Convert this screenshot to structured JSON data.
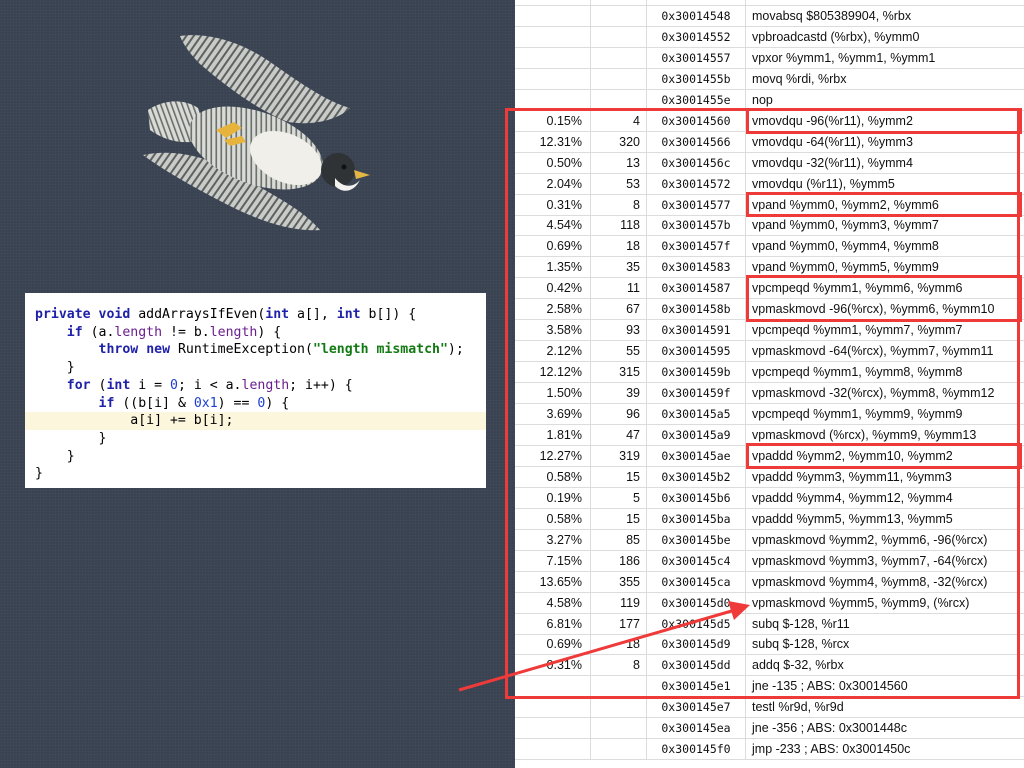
{
  "code": {
    "lines": [
      [
        [
          "kw",
          "private"
        ],
        [
          "",
          " "
        ],
        [
          "kw",
          "void"
        ],
        [
          "",
          " addArraysIfEven("
        ],
        [
          "kw",
          "int"
        ],
        [
          "",
          " a[], "
        ],
        [
          "kw",
          "int"
        ],
        [
          "",
          " b[]) {"
        ]
      ],
      [
        [
          "",
          "    "
        ],
        [
          "kw",
          "if"
        ],
        [
          "",
          " (a."
        ],
        [
          "fld",
          "length"
        ],
        [
          "",
          " != b."
        ],
        [
          "fld",
          "length"
        ],
        [
          "",
          ") {"
        ]
      ],
      [
        [
          "",
          "        "
        ],
        [
          "kw",
          "throw"
        ],
        [
          "",
          " "
        ],
        [
          "kw",
          "new"
        ],
        [
          "",
          " RuntimeException("
        ],
        [
          "str",
          "\"length mismatch\""
        ],
        [
          "",
          ");"
        ]
      ],
      [
        [
          "",
          "    }"
        ]
      ],
      [
        [
          "",
          "    "
        ],
        [
          "kw",
          "for"
        ],
        [
          "",
          " ("
        ],
        [
          "kw",
          "int"
        ],
        [
          "",
          " i = "
        ],
        [
          "num",
          "0"
        ],
        [
          "",
          "; i < a."
        ],
        [
          "fld",
          "length"
        ],
        [
          "",
          "; i++) {"
        ]
      ],
      [
        [
          "",
          "        "
        ],
        [
          "kw",
          "if"
        ],
        [
          "",
          " ((b[i] & "
        ],
        [
          "num",
          "0x1"
        ],
        [
          "",
          ") == "
        ],
        [
          "num",
          "0"
        ],
        [
          "",
          ") {"
        ]
      ],
      [
        [
          "",
          "            a[i] += b[i];"
        ]
      ],
      [
        [
          "",
          "        }"
        ]
      ],
      [
        [
          "",
          "    }"
        ]
      ],
      [
        [
          "",
          "}"
        ]
      ]
    ],
    "highlight_line": 6
  },
  "asm": {
    "rows": [
      [
        "",
        "",
        "",
        ""
      ],
      [
        "",
        "",
        "0x30014548",
        "movabsq $805389904, %rbx"
      ],
      [
        "",
        "",
        "0x30014552",
        "vpbroadcastd (%rbx), %ymm0"
      ],
      [
        "",
        "",
        "0x30014557",
        "vpxor %ymm1, %ymm1, %ymm1"
      ],
      [
        "",
        "",
        "0x3001455b",
        "movq %rdi, %rbx"
      ],
      [
        "",
        "",
        "0x3001455e",
        "nop"
      ],
      [
        "0.15%",
        "4",
        "0x30014560",
        "vmovdqu -96(%r11), %ymm2"
      ],
      [
        "12.31%",
        "320",
        "0x30014566",
        "vmovdqu -64(%r11), %ymm3"
      ],
      [
        "0.50%",
        "13",
        "0x3001456c",
        "vmovdqu -32(%r11), %ymm4"
      ],
      [
        "2.04%",
        "53",
        "0x30014572",
        "vmovdqu (%r11), %ymm5"
      ],
      [
        "0.31%",
        "8",
        "0x30014577",
        "vpand %ymm0, %ymm2, %ymm6"
      ],
      [
        "4.54%",
        "118",
        "0x3001457b",
        "vpand %ymm0, %ymm3, %ymm7"
      ],
      [
        "0.69%",
        "18",
        "0x3001457f",
        "vpand %ymm0, %ymm4, %ymm8"
      ],
      [
        "1.35%",
        "35",
        "0x30014583",
        "vpand %ymm0, %ymm5, %ymm9"
      ],
      [
        "0.42%",
        "11",
        "0x30014587",
        "vpcmpeqd %ymm1, %ymm6, %ymm6"
      ],
      [
        "2.58%",
        "67",
        "0x3001458b",
        "vpmaskmovd -96(%rcx), %ymm6, %ymm10"
      ],
      [
        "3.58%",
        "93",
        "0x30014591",
        "vpcmpeqd %ymm1, %ymm7, %ymm7"
      ],
      [
        "2.12%",
        "55",
        "0x30014595",
        "vpmaskmovd -64(%rcx), %ymm7, %ymm11"
      ],
      [
        "12.12%",
        "315",
        "0x3001459b",
        "vpcmpeqd %ymm1, %ymm8, %ymm8"
      ],
      [
        "1.50%",
        "39",
        "0x3001459f",
        "vpmaskmovd -32(%rcx), %ymm8, %ymm12"
      ],
      [
        "3.69%",
        "96",
        "0x300145a5",
        "vpcmpeqd %ymm1, %ymm9, %ymm9"
      ],
      [
        "1.81%",
        "47",
        "0x300145a9",
        "vpmaskmovd (%rcx), %ymm9, %ymm13"
      ],
      [
        "12.27%",
        "319",
        "0x300145ae",
        "vpaddd %ymm2, %ymm10, %ymm2"
      ],
      [
        "0.58%",
        "15",
        "0x300145b2",
        "vpaddd %ymm3, %ymm11, %ymm3"
      ],
      [
        "0.19%",
        "5",
        "0x300145b6",
        "vpaddd %ymm4, %ymm12, %ymm4"
      ],
      [
        "0.58%",
        "15",
        "0x300145ba",
        "vpaddd %ymm5, %ymm13, %ymm5"
      ],
      [
        "3.27%",
        "85",
        "0x300145be",
        "vpmaskmovd %ymm2, %ymm6, -96(%rcx)"
      ],
      [
        "7.15%",
        "186",
        "0x300145c4",
        "vpmaskmovd %ymm3, %ymm7, -64(%rcx)"
      ],
      [
        "13.65%",
        "355",
        "0x300145ca",
        "vpmaskmovd %ymm4, %ymm8, -32(%rcx)"
      ],
      [
        "4.58%",
        "119",
        "0x300145d0",
        "vpmaskmovd %ymm5, %ymm9, (%rcx)"
      ],
      [
        "6.81%",
        "177",
        "0x300145d5",
        "subq $-128, %r11"
      ],
      [
        "0.69%",
        "18",
        "0x300145d9",
        "subq $-128, %rcx"
      ],
      [
        "0.31%",
        "8",
        "0x300145dd",
        "addq $-32, %rbx"
      ],
      [
        "",
        "",
        "0x300145e1",
        "jne -135 ; ABS: 0x30014560"
      ],
      [
        "",
        "",
        "0x300145e7",
        "testl %r9d, %r9d"
      ],
      [
        "",
        "",
        "0x300145ea",
        "jne -356 ; ABS: 0x3001448c"
      ],
      [
        "",
        "",
        "0x300145f0",
        "jmp -233 ; ABS: 0x3001450c"
      ]
    ],
    "boxes": [
      {
        "from": 6,
        "to": 33,
        "name": "loop-body-box"
      },
      {
        "from": 6,
        "to": 6,
        "name": "load-box"
      },
      {
        "from": 10,
        "to": 10,
        "name": "mask-box"
      },
      {
        "from": 14,
        "to": 15,
        "name": "compare-maskload-box"
      },
      {
        "from": 22,
        "to": 22,
        "name": "add-box"
      }
    ]
  },
  "colors": {
    "background": "#3a4352",
    "annotation_red": "#ef3a3a",
    "keyword": "#1f22a8",
    "field": "#6b1f8f",
    "string": "#127a12",
    "number": "#1c3fd0",
    "highlight": "#fcf6dc"
  },
  "image": {
    "subject": "peregrine falcon in flight",
    "icon": "falcon-image"
  }
}
